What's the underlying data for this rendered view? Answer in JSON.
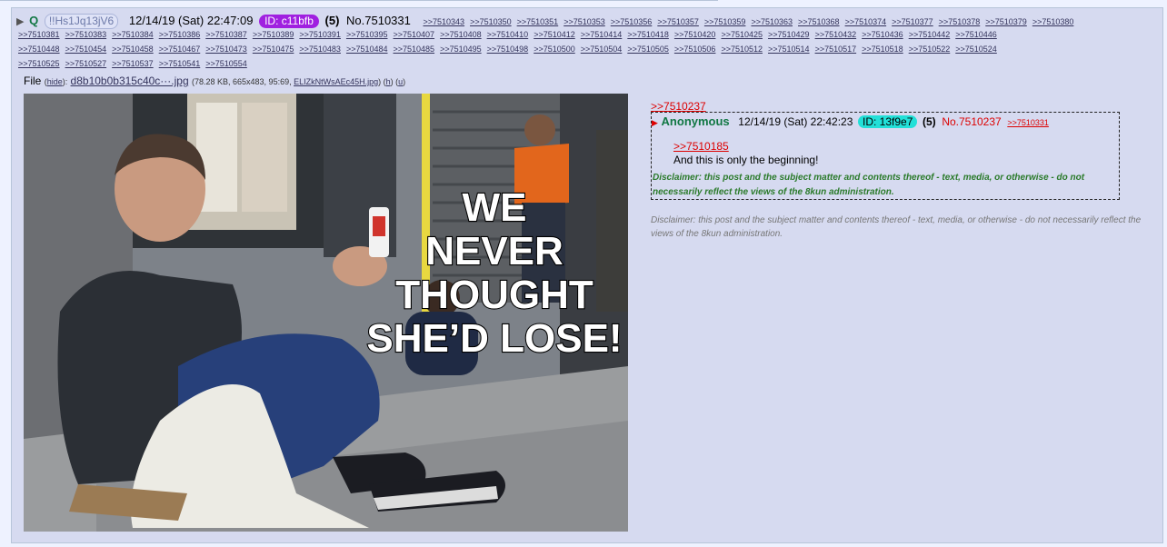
{
  "post": {
    "arrow": "▶",
    "name": "Q",
    "tripcode": "!!Hs1Jq13jV6",
    "date": "12/14/19 (Sat) 22:47:09",
    "id_label": "ID: c11bfb",
    "id_color": "#a020e0",
    "post_count": "(5)",
    "post_number": "No.7510331",
    "mentions_row1": [
      ">>7510343",
      ">>7510350",
      ">>7510351",
      ">>7510353",
      ">>7510356",
      ">>7510357",
      ">>7510359",
      ">>7510363",
      ">>7510368",
      ">>7510374",
      ">>7510377",
      ">>7510378",
      ">>7510379",
      ">>7510380"
    ],
    "mentions_row2": [
      ">>7510381",
      ">>7510383",
      ">>7510384",
      ">>7510386",
      ">>7510387",
      ">>7510389",
      ">>7510391",
      ">>7510395",
      ">>7510407",
      ">>7510408",
      ">>7510410",
      ">>7510412",
      ">>7510414",
      ">>7510418",
      ">>7510420",
      ">>7510425",
      ">>7510429",
      ">>7510432",
      ">>7510436",
      ">>7510442",
      ">>7510446"
    ],
    "mentions_row3": [
      ">>7510448",
      ">>7510454",
      ">>7510458",
      ">>7510467",
      ">>7510473",
      ">>7510475",
      ">>7510483",
      ">>7510484",
      ">>7510485",
      ">>7510495",
      ">>7510498",
      ">>7510500",
      ">>7510504",
      ">>7510505",
      ">>7510506",
      ">>7510512",
      ">>7510514",
      ">>7510517",
      ">>7510518",
      ">>7510522",
      ">>7510524"
    ],
    "mentions_row4": [
      ">>7510525",
      ">>7510527",
      ">>7510537",
      ">>7510541",
      ">>7510554"
    ]
  },
  "file": {
    "label": "File",
    "hide": "hide",
    "filename": "d8b10b0b315c40c···.jpg",
    "meta_prefix": "(78.28 KB, 665x483, 95:69, ",
    "original_name": "ELIZkNtWsAEc45H.jpg",
    "h_link": "h",
    "u_link": "u",
    "meta_suffix": ")"
  },
  "image": {
    "caption_lines": [
      "WE",
      "NEVER",
      "THOUGHT",
      "SHE’D LOSE!"
    ]
  },
  "reply": {
    "backlink": ">>7510237",
    "name": "Anonymous",
    "date": "12/14/19 (Sat) 22:42:23",
    "id_label": "ID: 13f9e7",
    "id_color": "#22e0d8",
    "post_count": "(5)",
    "post_number": "No.7510237",
    "reply_backlink": ">>7510331",
    "quote": ">>7510185",
    "body": "And this is only the beginning!",
    "disclaimer_inner": "Disclaimer: this post and the subject matter and contents thereof - text, media, or otherwise - do not necessarily reflect the views of the 8kun administration."
  },
  "disclaimer_outer": "Disclaimer: this post and the subject matter and contents thereof - text, media, or otherwise - do not necessarily reflect the views of the 8kun administration."
}
